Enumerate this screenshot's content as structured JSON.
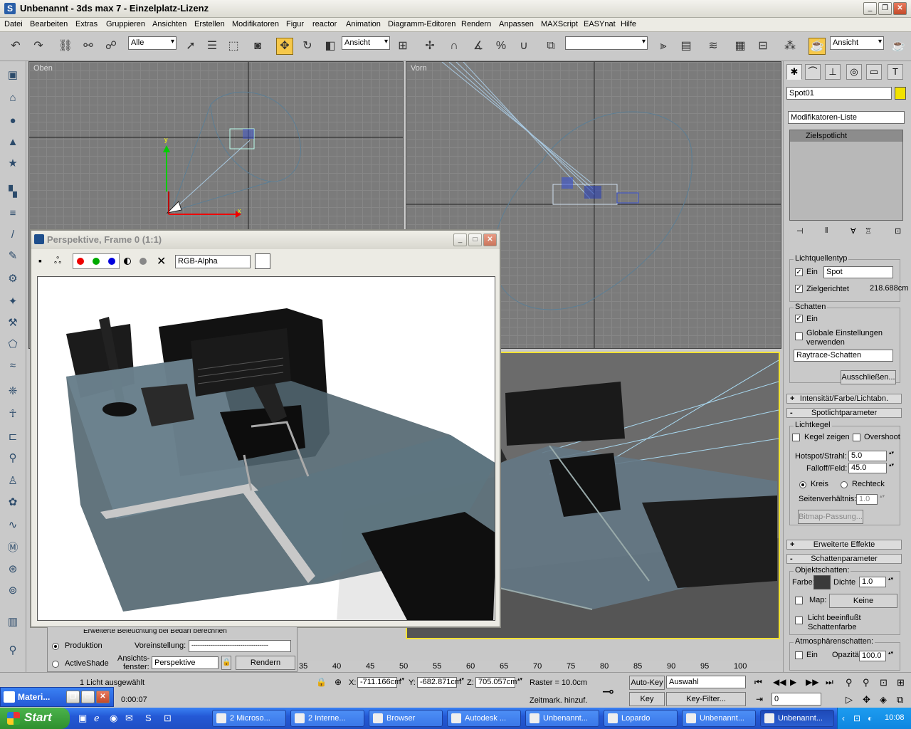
{
  "window": {
    "title": "Unbenannt  - 3ds max 7  - Einzelplatz-Lizenz",
    "app_icon": "S"
  },
  "menu": [
    "Datei",
    "Bearbeiten",
    "Extras",
    "Gruppieren",
    "Ansichten",
    "Erstellen",
    "Modifikatoren",
    "Figur",
    "reactor",
    "Animation",
    "Diagramm-Editoren",
    "Rendern",
    "Anpassen",
    "MAXScript",
    "EASYnat",
    "Hilfe"
  ],
  "toolbar": {
    "selection_filter": "Alle",
    "ref_coord": "Ansicht",
    "named_selection": "",
    "render_type": "Ansicht"
  },
  "viewports": {
    "top_label": "Oben",
    "front_label": "Vorn",
    "axis_x": "x",
    "axis_y": "y"
  },
  "command_panel": {
    "object_name": "Spot01",
    "object_color": "#f2e200",
    "modifier_list": "Modifikatoren-Liste",
    "stack_item": "Zielspotlicht",
    "light_type": {
      "title": "Lichtquellentyp",
      "on_label": "Ein",
      "type": "Spot",
      "targeted_label": "Zielgerichtet",
      "target_dist": "218.688cm"
    },
    "shadows": {
      "title": "Schatten",
      "on_label": "Ein",
      "global_label_1": "Globale Einstellungen",
      "global_label_2": "verwenden",
      "type": "Raytrace-Schatten",
      "exclude": "Ausschließen..."
    },
    "rollouts": {
      "intensity": "Intensität/Farbe/Lichtabn.",
      "spot_params": "Spotlichtparameter",
      "advanced": "Erweiterte Effekte",
      "shadow_params": "Schattenparameter"
    },
    "cone": {
      "title": "Lichtkegel",
      "show_cone": "Kegel zeigen",
      "overshoot": "Overshoot",
      "hotspot_label": "Hotspot/Strahl:",
      "hotspot": "5.0",
      "falloff_label": "Falloff/Feld:",
      "falloff": "45.0",
      "circle": "Kreis",
      "rect": "Rechteck",
      "aspect_label": "Seitenverhältnis:",
      "aspect": "1.0",
      "bitmap": "Bitmap-Passung..."
    },
    "shadow_params": {
      "object_title": "Objektschatten:",
      "color_label": "Farbe:",
      "density_label": "Dichte",
      "density": "1.0",
      "map_label": "Map:",
      "map_button": "Keine",
      "light_affects_1": "Licht beeinflußt",
      "light_affects_2": "Schattenfarbe",
      "atmos_title": "Atmosphärenschatten:",
      "atmos_on": "Ein",
      "opacity_label": "Opazität:",
      "opacity": "100.0"
    }
  },
  "render_window": {
    "title": "Perspektive, Frame 0 (1:1)",
    "channel": "RGB-Alpha"
  },
  "render_options": {
    "partial_text": "Erweiterte Beleuchtung bei Bedarf berechnen",
    "production": "Produktion",
    "activeshade": "ActiveShade",
    "preset_label": "Voreinstellung:",
    "preset_value": "------------------------------------",
    "view_label_1": "Ansichts-",
    "view_label_2": "fenster:",
    "view_value": "Perspektive",
    "render_button": "Rendern"
  },
  "timeline": {
    "ticks": [
      "35",
      "40",
      "45",
      "50",
      "55",
      "60",
      "65",
      "70",
      "75",
      "80",
      "85",
      "90",
      "95",
      "100"
    ]
  },
  "status": {
    "selection": "1 Licht ausgewählt",
    "time_text": "0:00:07",
    "x_label": "X:",
    "x": "-711.166cm",
    "y_label": "Y:",
    "y": "-682.871cm",
    "z_label": "Z:",
    "z": "705.057cm",
    "grid": "Raster = 10.0cm",
    "time_tag": "Zeitmark. hinzuf.",
    "autokey": "Auto-Key",
    "autokey_mode": "Auswahl",
    "setkey": "Key einst.",
    "keyfilter": "Key-Filter...",
    "frame": "0"
  },
  "material_window": {
    "title": "Materi..."
  },
  "taskbar": {
    "start": "Start",
    "tasks": [
      {
        "label": "2 Microso...",
        "active": false
      },
      {
        "label": "2 Interne...",
        "active": false
      },
      {
        "label": "Browser",
        "active": false
      },
      {
        "label": "Autodesk ...",
        "active": false
      },
      {
        "label": "Unbenannt...",
        "active": false
      },
      {
        "label": "Lopardo",
        "active": false
      },
      {
        "label": "Unbenannt...",
        "active": false
      },
      {
        "label": "Unbenannt...",
        "active": true
      }
    ],
    "clock": "10:08"
  }
}
